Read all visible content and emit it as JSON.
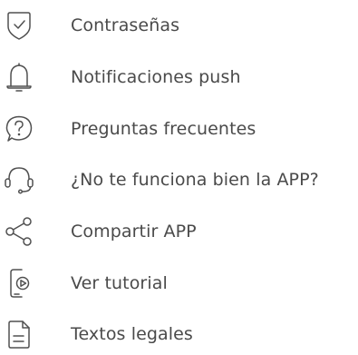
{
  "menu": {
    "items": [
      {
        "key": "passwords",
        "label": "Contraseñas",
        "icon": "shield-check-icon"
      },
      {
        "key": "push",
        "label": "Notificaciones push",
        "icon": "bell-icon"
      },
      {
        "key": "faq",
        "label": "Preguntas frecuentes",
        "icon": "question-circle-icon"
      },
      {
        "key": "support",
        "label": "¿No te funciona bien la APP?",
        "icon": "headset-icon"
      },
      {
        "key": "share",
        "label": "Compartir APP",
        "icon": "share-icon"
      },
      {
        "key": "tutorial",
        "label": "Ver tutorial",
        "icon": "phone-play-icon"
      },
      {
        "key": "legal",
        "label": "Textos legales",
        "icon": "document-icon"
      }
    ]
  },
  "colors": {
    "text": "#4a4a4a",
    "icon_stroke": "#505050",
    "background": "#ffffff"
  }
}
